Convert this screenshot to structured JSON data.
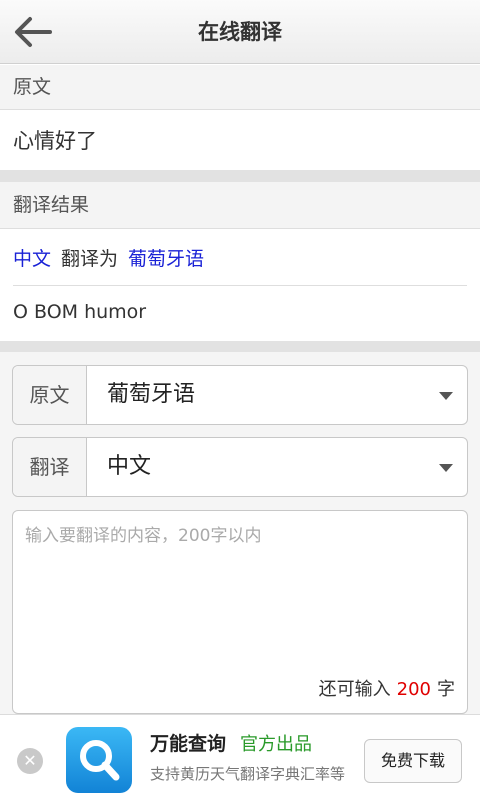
{
  "header": {
    "title": "在线翻译",
    "back_icon": "back-arrow-icon"
  },
  "source_section": {
    "heading": "原文",
    "text": "心情好了"
  },
  "result_section": {
    "heading": "翻译结果",
    "from_lang": "中文",
    "connector": "翻译为",
    "to_lang": "葡萄牙语",
    "translation": "O BOM humor"
  },
  "selectors": [
    {
      "label": "原文",
      "value": "葡萄牙语"
    },
    {
      "label": "翻译",
      "value": "中文"
    }
  ],
  "input": {
    "placeholder": "输入要翻译的内容，200字以内",
    "value": "",
    "counter_prefix": "还可输入",
    "counter_number": "200",
    "counter_suffix": "字"
  },
  "ad": {
    "close_icon": "close-icon",
    "logo_icon": "magnifier-app-icon",
    "title": "万能查询",
    "official": "官方出品",
    "description": "支持黄历天气翻译字典汇率等",
    "button": "免费下载"
  },
  "colors": {
    "link_blue": "#1a22d6",
    "counter_red": "#e00000",
    "official_green": "#2a9a2a",
    "app_icon_blue": "#1283d6"
  }
}
